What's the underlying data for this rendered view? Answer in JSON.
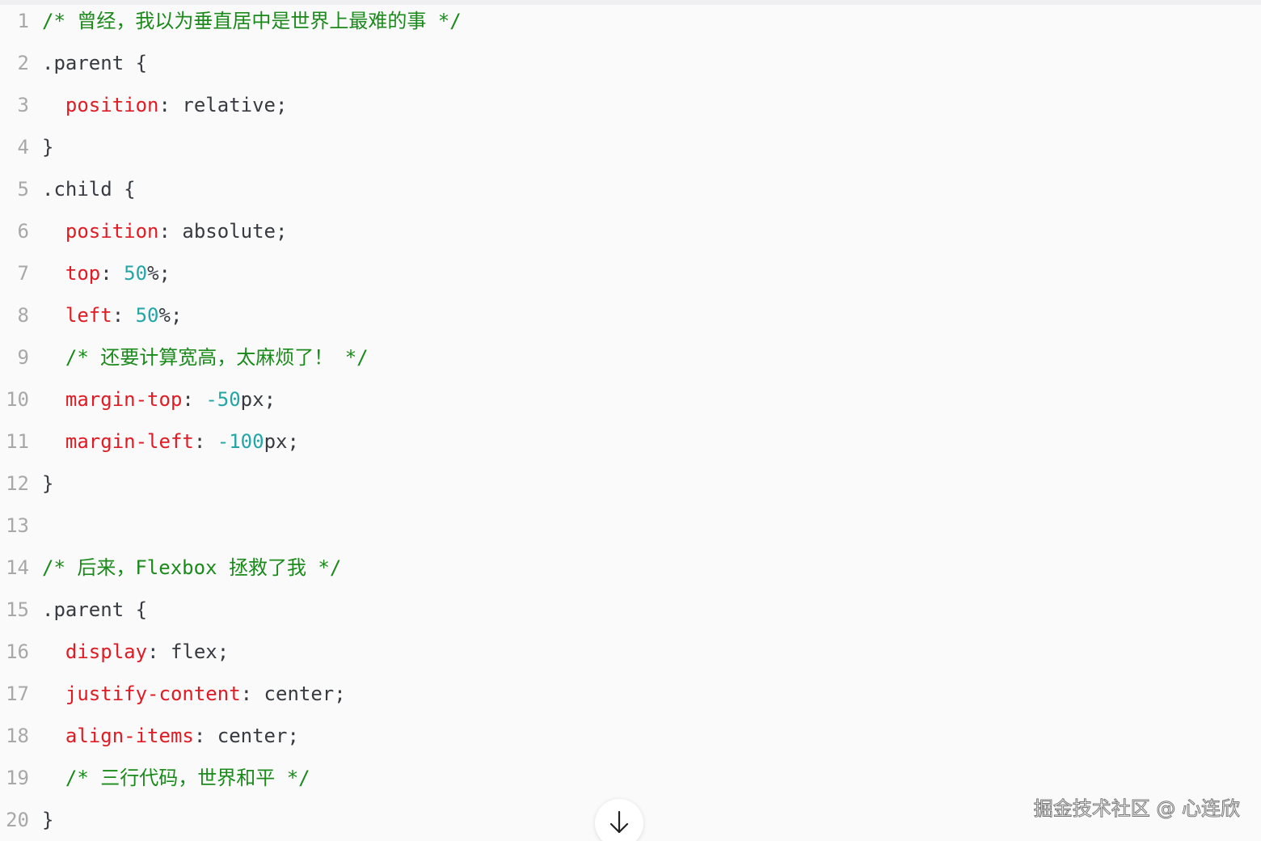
{
  "code_block": {
    "language": "css",
    "lines": [
      {
        "n": "1",
        "tokens": [
          {
            "t": "/* 曾经，我以为垂直居中是世界上最难的事 */",
            "k": "cm"
          }
        ]
      },
      {
        "n": "2",
        "tokens": [
          {
            "t": ".parent {",
            "k": "pl"
          }
        ]
      },
      {
        "n": "3",
        "tokens": [
          {
            "t": "  ",
            "k": "pl"
          },
          {
            "t": "position",
            "k": "pr"
          },
          {
            "t": ": relative;",
            "k": "pl"
          }
        ]
      },
      {
        "n": "4",
        "tokens": [
          {
            "t": "}",
            "k": "pl"
          }
        ]
      },
      {
        "n": "5",
        "tokens": [
          {
            "t": ".child {",
            "k": "pl"
          }
        ]
      },
      {
        "n": "6",
        "tokens": [
          {
            "t": "  ",
            "k": "pl"
          },
          {
            "t": "position",
            "k": "pr"
          },
          {
            "t": ": absolute;",
            "k": "pl"
          }
        ]
      },
      {
        "n": "7",
        "tokens": [
          {
            "t": "  ",
            "k": "pl"
          },
          {
            "t": "top",
            "k": "pr"
          },
          {
            "t": ": ",
            "k": "pl"
          },
          {
            "t": "50",
            "k": "nm"
          },
          {
            "t": "%;",
            "k": "pl"
          }
        ]
      },
      {
        "n": "8",
        "tokens": [
          {
            "t": "  ",
            "k": "pl"
          },
          {
            "t": "left",
            "k": "pr"
          },
          {
            "t": ": ",
            "k": "pl"
          },
          {
            "t": "50",
            "k": "nm"
          },
          {
            "t": "%;",
            "k": "pl"
          }
        ]
      },
      {
        "n": "9",
        "tokens": [
          {
            "t": "  ",
            "k": "pl"
          },
          {
            "t": "/* 还要计算宽高，太麻烦了！ */",
            "k": "cm"
          }
        ]
      },
      {
        "n": "10",
        "tokens": [
          {
            "t": "  ",
            "k": "pl"
          },
          {
            "t": "margin-top",
            "k": "pr"
          },
          {
            "t": ": ",
            "k": "pl"
          },
          {
            "t": "-50",
            "k": "nm"
          },
          {
            "t": "px;",
            "k": "pl"
          }
        ]
      },
      {
        "n": "11",
        "tokens": [
          {
            "t": "  ",
            "k": "pl"
          },
          {
            "t": "margin-left",
            "k": "pr"
          },
          {
            "t": ": ",
            "k": "pl"
          },
          {
            "t": "-100",
            "k": "nm"
          },
          {
            "t": "px;",
            "k": "pl"
          }
        ]
      },
      {
        "n": "12",
        "tokens": [
          {
            "t": "}",
            "k": "pl"
          }
        ]
      },
      {
        "n": "13",
        "tokens": []
      },
      {
        "n": "14",
        "tokens": [
          {
            "t": "/* 后来，Flexbox 拯救了我 */",
            "k": "cm"
          }
        ]
      },
      {
        "n": "15",
        "tokens": [
          {
            "t": ".parent {",
            "k": "pl"
          }
        ]
      },
      {
        "n": "16",
        "tokens": [
          {
            "t": "  ",
            "k": "pl"
          },
          {
            "t": "display",
            "k": "pr"
          },
          {
            "t": ": flex;",
            "k": "pl"
          }
        ]
      },
      {
        "n": "17",
        "tokens": [
          {
            "t": "  ",
            "k": "pl"
          },
          {
            "t": "justify-content",
            "k": "pr"
          },
          {
            "t": ": center;",
            "k": "pl"
          }
        ]
      },
      {
        "n": "18",
        "tokens": [
          {
            "t": "  ",
            "k": "pl"
          },
          {
            "t": "align-items",
            "k": "pr"
          },
          {
            "t": ": center;",
            "k": "pl"
          }
        ]
      },
      {
        "n": "19",
        "tokens": [
          {
            "t": "  ",
            "k": "pl"
          },
          {
            "t": "/* 三行代码，世界和平 */",
            "k": "cm"
          }
        ]
      },
      {
        "n": "20",
        "tokens": [
          {
            "t": "}",
            "k": "pl"
          }
        ]
      }
    ]
  },
  "scroll_button": {
    "icon": "arrow-down-icon"
  },
  "watermark": {
    "text": "掘金技术社区 @ 心连欣"
  },
  "colors": {
    "comment": "#1a8a1a",
    "property": "#e01b24",
    "number": "#23a6a6",
    "plain": "#383a42",
    "line_number": "#a8a8a8",
    "background": "#fafafa"
  }
}
